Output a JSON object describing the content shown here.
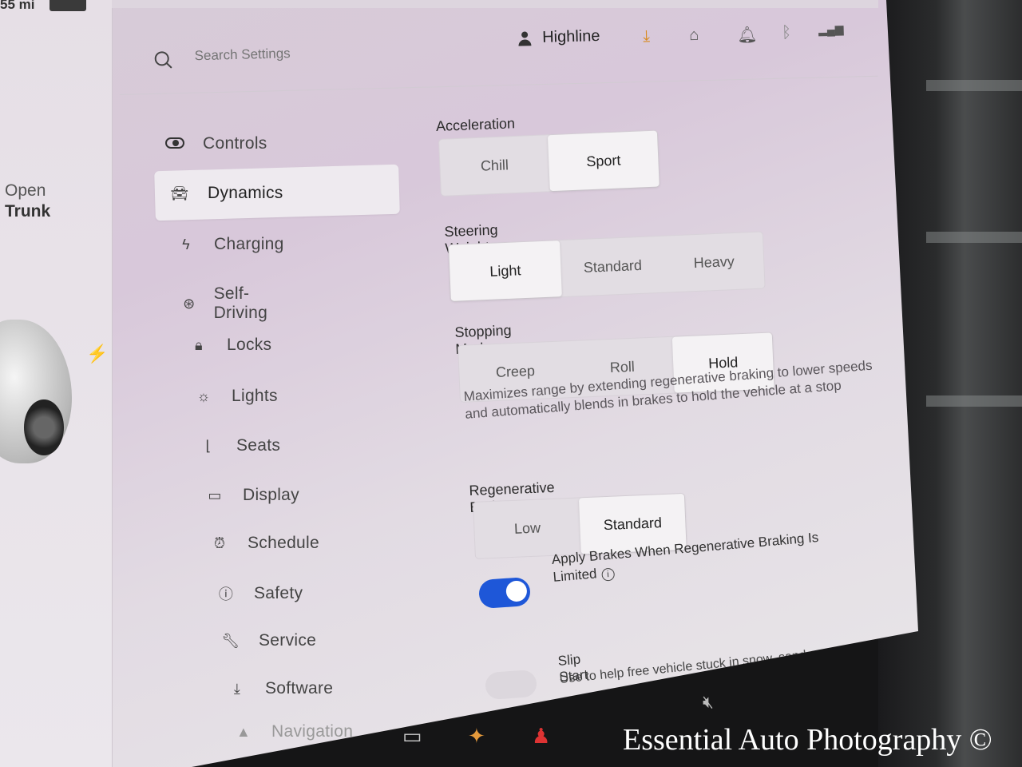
{
  "status": {
    "range": "55 mi"
  },
  "left_panel": {
    "open_trunk_line1": "Open",
    "open_trunk_line2": "Trunk"
  },
  "search": {
    "placeholder": "Search Settings"
  },
  "profile": {
    "name": "Highline"
  },
  "top_icons": [
    "download-icon",
    "garage-icon",
    "bell-icon",
    "bluetooth-icon",
    "lte-signal-icon"
  ],
  "nav": {
    "items": [
      {
        "label": "Controls",
        "icon": "toggle-icon"
      },
      {
        "label": "Dynamics",
        "icon": "car-icon",
        "selected": true
      },
      {
        "label": "Charging",
        "icon": "bolt-icon"
      },
      {
        "label": "Self-Driving",
        "icon": "steering-wheel-icon"
      },
      {
        "label": "Locks",
        "icon": "lock-icon"
      },
      {
        "label": "Lights",
        "icon": "sun-icon"
      },
      {
        "label": "Seats",
        "icon": "seat-icon"
      },
      {
        "label": "Display",
        "icon": "display-icon"
      },
      {
        "label": "Schedule",
        "icon": "clock-icon"
      },
      {
        "label": "Safety",
        "icon": "alert-icon"
      },
      {
        "label": "Service",
        "icon": "wrench-icon"
      },
      {
        "label": "Software",
        "icon": "download-icon"
      },
      {
        "label": "Navigation",
        "icon": "navigation-icon"
      }
    ]
  },
  "dynamics": {
    "acceleration": {
      "title": "Acceleration",
      "options": [
        "Chill",
        "Sport"
      ],
      "selected": "Sport"
    },
    "steering_weight": {
      "title": "Steering Weight",
      "options": [
        "Light",
        "Standard",
        "Heavy"
      ],
      "selected": "Light"
    },
    "stopping_mode": {
      "title": "Stopping Mode",
      "options": [
        "Creep",
        "Roll",
        "Hold"
      ],
      "selected": "Hold",
      "description": "Maximizes range by extending regenerative braking to lower speeds and automatically blends in brakes to hold the vehicle at a stop"
    },
    "regenerative_braking": {
      "title": "Regenerative Braking",
      "options": [
        "Low",
        "Standard"
      ],
      "selected": "Standard"
    },
    "apply_brakes": {
      "label": "Apply Brakes When Regenerative Braking Is Limited",
      "enabled": true
    },
    "slip_start": {
      "title": "Slip Start",
      "description": "Use to help free vehicle stuck in snow, sand, or mud.",
      "enabled": false
    }
  },
  "watermark": "Essential Auto Photography ©",
  "colors": {
    "accent": "#1e57d8",
    "screen_bg": "#e2dbe3"
  }
}
